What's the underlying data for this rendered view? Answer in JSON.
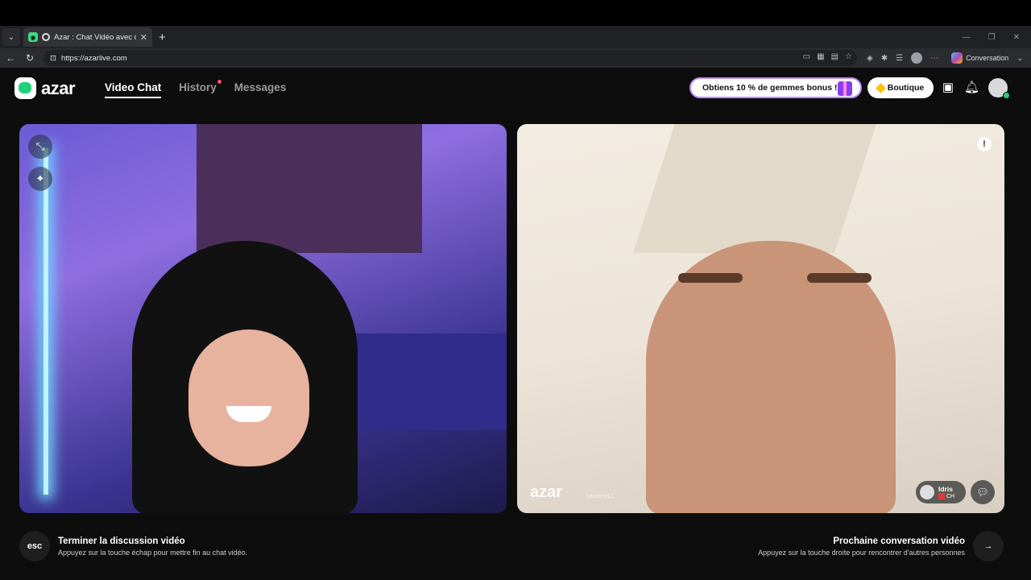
{
  "browser": {
    "tab_title": "Azar : Chat Vidéo avec de nou",
    "url": "https://azarlive.com",
    "copilot_label": "Conversation"
  },
  "header": {
    "logo_text": "azar",
    "nav": [
      {
        "label": "Video Chat",
        "active": true
      },
      {
        "label": "History",
        "has_dot": true
      },
      {
        "label": "Messages"
      }
    ],
    "promo_label": "Obtiens 10 % de gemmes bonus !",
    "shop_label": "Boutique"
  },
  "remote": {
    "watermark": "azar",
    "watermark_handle": "tutulazarLC",
    "user_name": "Idris",
    "user_country": "CH"
  },
  "footer": {
    "left_key": "esc",
    "left_title": "Terminer la discussion vidéo",
    "left_sub": "Appuyez sur la touche échap pour mettre fin au chat vidéo.",
    "right_title": "Prochaine conversation vidéo",
    "right_sub": "Appuyez sur la touche droite pour rencontrer d'autres personnes"
  },
  "colors": {
    "brand_green": "#23d07a",
    "notif_dot": "#ff4d6d"
  }
}
